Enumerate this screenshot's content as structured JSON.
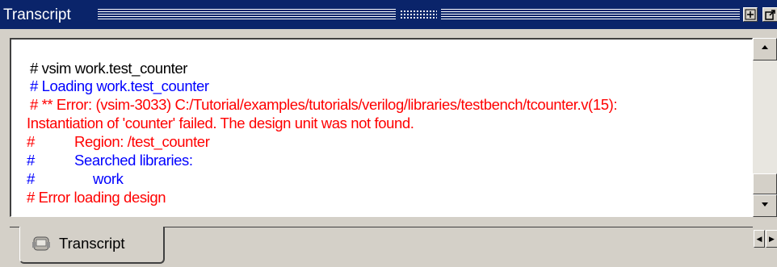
{
  "window": {
    "title": "Transcript",
    "buttons": {
      "zoom_icon": "zoom-icon",
      "undock_icon": "undock-icon"
    }
  },
  "transcript": {
    "lines": [
      {
        "text": "# vsim work.test_counter",
        "color": "#000000"
      },
      {
        "text": "# Loading work.test_counter",
        "color": "#0000ff"
      },
      {
        "text": "# ** Error: (vsim-3033) C:/Tutorial/examples/tutorials/verilog/libraries/testbench/tcounter.v(15):",
        "color": "#ff0000"
      },
      {
        "text": "Instantiation of 'counter' failed. The design unit was not found.",
        "color": "#ff0000"
      },
      {
        "prefix": "#",
        "text": "Region: /test_counter",
        "color": "#ff0000"
      },
      {
        "prefix": "#",
        "text": "Searched libraries:",
        "color": "#0000ff"
      },
      {
        "prefix": "#",
        "text": "work",
        "color": "#0000ff"
      },
      {
        "text": "# Error loading design",
        "color": "#ff0000"
      }
    ]
  },
  "tabs": [
    {
      "label": "Transcript",
      "icon": "transcript-icon",
      "active": true
    }
  ],
  "colors": {
    "titlebar": "#0a246a",
    "background": "#d4d0c8",
    "info": "#0000ff",
    "error": "#ff0000",
    "command": "#000000"
  }
}
